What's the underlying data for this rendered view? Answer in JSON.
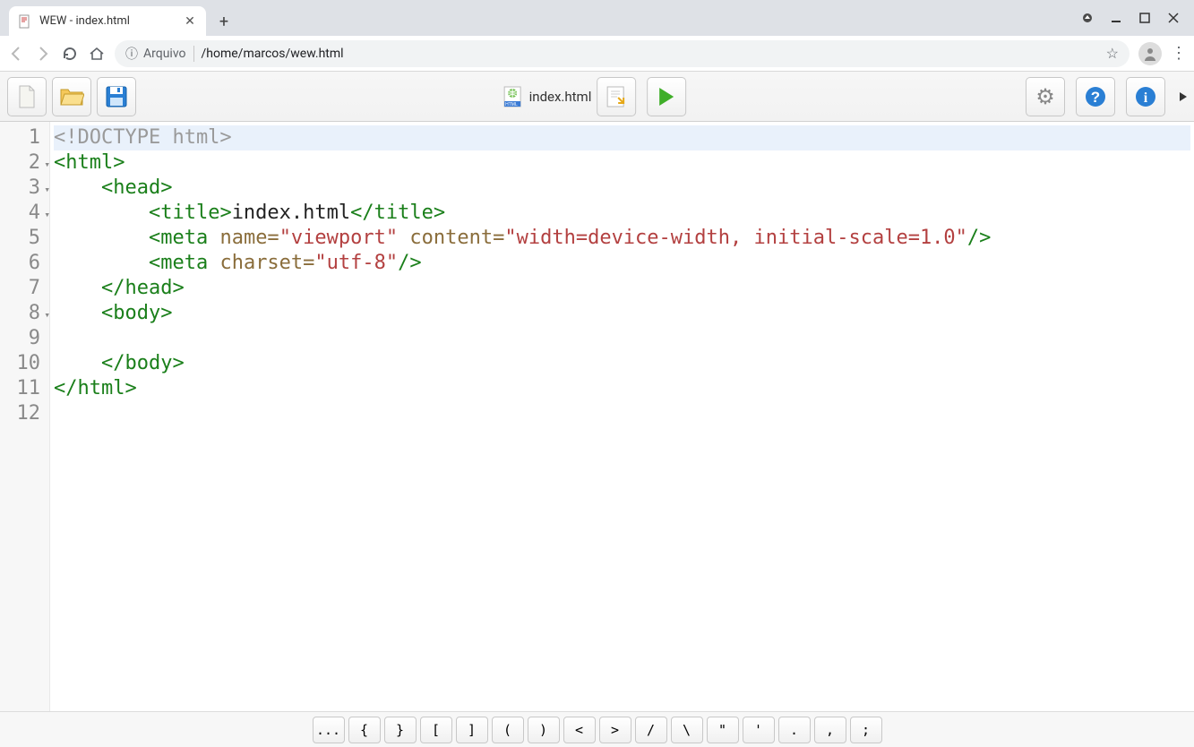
{
  "window": {
    "title": "WEW - index.html"
  },
  "url": {
    "scheme_label": "Arquivo",
    "path": "/home/marcos/wew.html"
  },
  "toolbar": {
    "current_file": "index.html"
  },
  "code": {
    "lines": [
      {
        "n": "1",
        "fold": false,
        "html": "<span class='c-decl'>&lt;!DOCTYPE html&gt;</span>",
        "active": true
      },
      {
        "n": "2",
        "fold": true,
        "html": "<span class='c-tag'>&lt;html&gt;</span>"
      },
      {
        "n": "3",
        "fold": true,
        "html": "    <span class='c-tag'>&lt;head&gt;</span>"
      },
      {
        "n": "4",
        "fold": true,
        "html": "        <span class='c-tag'>&lt;title&gt;</span>index.html<span class='c-tag'>&lt;/title&gt;</span>"
      },
      {
        "n": "5",
        "fold": false,
        "html": "        <span class='c-tag'>&lt;meta</span> <span class='c-attr'>name=</span><span class='c-str'>\"viewport\"</span> <span class='c-attr'>content=</span><span class='c-str'>\"width=device-width, initial-scale=1.0\"</span><span class='c-tag'>/&gt;</span>"
      },
      {
        "n": "6",
        "fold": false,
        "html": "        <span class='c-tag'>&lt;meta</span> <span class='c-attr'>charset=</span><span class='c-str'>\"utf-8\"</span><span class='c-tag'>/&gt;</span>"
      },
      {
        "n": "7",
        "fold": false,
        "html": "    <span class='c-tag'>&lt;/head&gt;</span>"
      },
      {
        "n": "8",
        "fold": true,
        "html": "    <span class='c-tag'>&lt;body&gt;</span>"
      },
      {
        "n": "9",
        "fold": false,
        "html": ""
      },
      {
        "n": "10",
        "fold": false,
        "html": "    <span class='c-tag'>&lt;/body&gt;</span>"
      },
      {
        "n": "11",
        "fold": false,
        "html": "<span class='c-tag'>&lt;/html&gt;</span>"
      },
      {
        "n": "12",
        "fold": false,
        "html": ""
      }
    ]
  },
  "symbols": [
    "...",
    "{",
    "}",
    "[",
    "]",
    "(",
    ")",
    "<",
    ">",
    "/",
    "\\",
    "\"",
    "'",
    ".",
    ",",
    ";"
  ]
}
